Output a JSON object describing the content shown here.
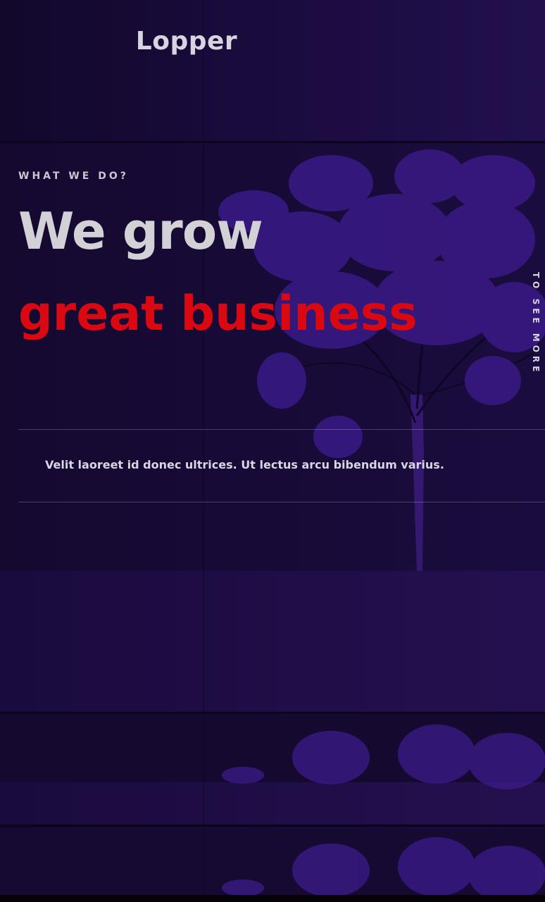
{
  "header": {
    "logo": "Lopper"
  },
  "hero": {
    "eyebrow": "WHAT WE DO?",
    "headline_line1": "We grow",
    "headline_line2": "great business",
    "scroll_hint": "TO SEE MORE",
    "description": "Velit laoreet id donec ultrices. Ut lectus arcu bibendum varius."
  },
  "colors": {
    "background": "#170a33",
    "headline_primary": "#d2d1d6",
    "headline_accent": "#d90811"
  },
  "icons": {
    "background_image": "tree-illustration"
  }
}
